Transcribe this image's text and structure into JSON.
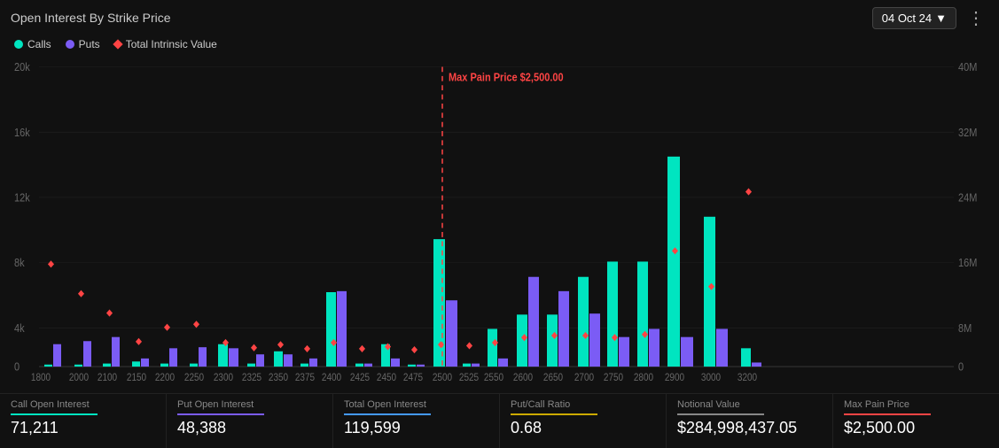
{
  "header": {
    "title": "Open Interest By Strike Price",
    "date": "04 Oct 24",
    "more_icon": "⋮"
  },
  "legend": {
    "calls_label": "Calls",
    "puts_label": "Puts",
    "intrinsic_label": "Total Intrinsic Value",
    "calls_color": "#00e5c0",
    "puts_color": "#7b5cf5"
  },
  "chart": {
    "max_pain_label": "Max Pain Price $2,500.00",
    "y_left_labels": [
      "20k",
      "16k",
      "12k",
      "8k",
      "4k",
      "0"
    ],
    "y_right_labels": [
      "40M",
      "32M",
      "24M",
      "16M",
      "8M",
      "0"
    ],
    "x_labels": [
      "1800",
      "2000",
      "2100",
      "2150",
      "2200",
      "2250",
      "2300",
      "2325",
      "2350",
      "2375",
      "2400",
      "2425",
      "2450",
      "2475",
      "2500",
      "2525",
      "2550",
      "2600",
      "2650",
      "2700",
      "2750",
      "2800",
      "2900",
      "3000",
      "3200"
    ]
  },
  "stats": [
    {
      "label": "Call Open Interest",
      "value": "71,211",
      "underline": "green"
    },
    {
      "label": "Put Open Interest",
      "value": "48,388",
      "underline": "purple"
    },
    {
      "label": "Total Open Interest",
      "value": "119,599",
      "underline": "blue"
    },
    {
      "label": "Put/Call Ratio",
      "value": "0.68",
      "underline": "yellow"
    },
    {
      "label": "Notional Value",
      "value": "$284,998,437.05",
      "underline": "gray"
    },
    {
      "label": "Max Pain Price",
      "value": "$2,500.00",
      "underline": "red"
    }
  ]
}
